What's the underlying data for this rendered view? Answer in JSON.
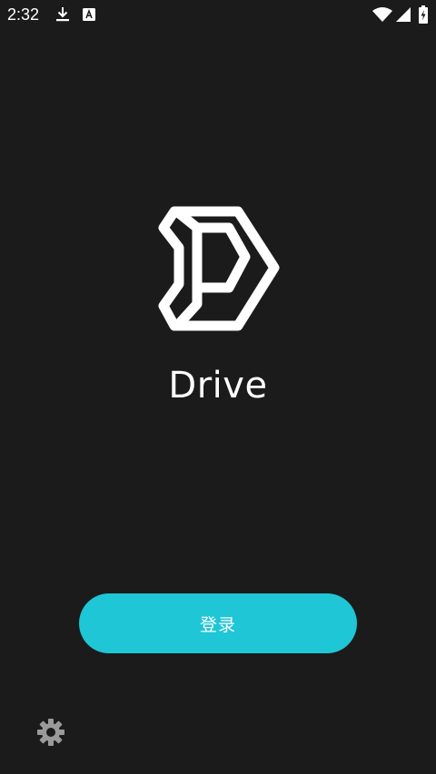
{
  "status_bar": {
    "time": "2:32",
    "icons": [
      "download-icon",
      "accessibility-a-icon",
      "wifi-icon",
      "signal-icon",
      "battery-charging-icon"
    ]
  },
  "app": {
    "name": "Drive",
    "logo": "drive-logo-icon"
  },
  "login": {
    "label": "登录"
  },
  "settings": {
    "icon": "gear-icon"
  },
  "colors": {
    "background": "#1b1b1b",
    "accent": "#1ec6d6",
    "foreground": "#ffffff"
  }
}
